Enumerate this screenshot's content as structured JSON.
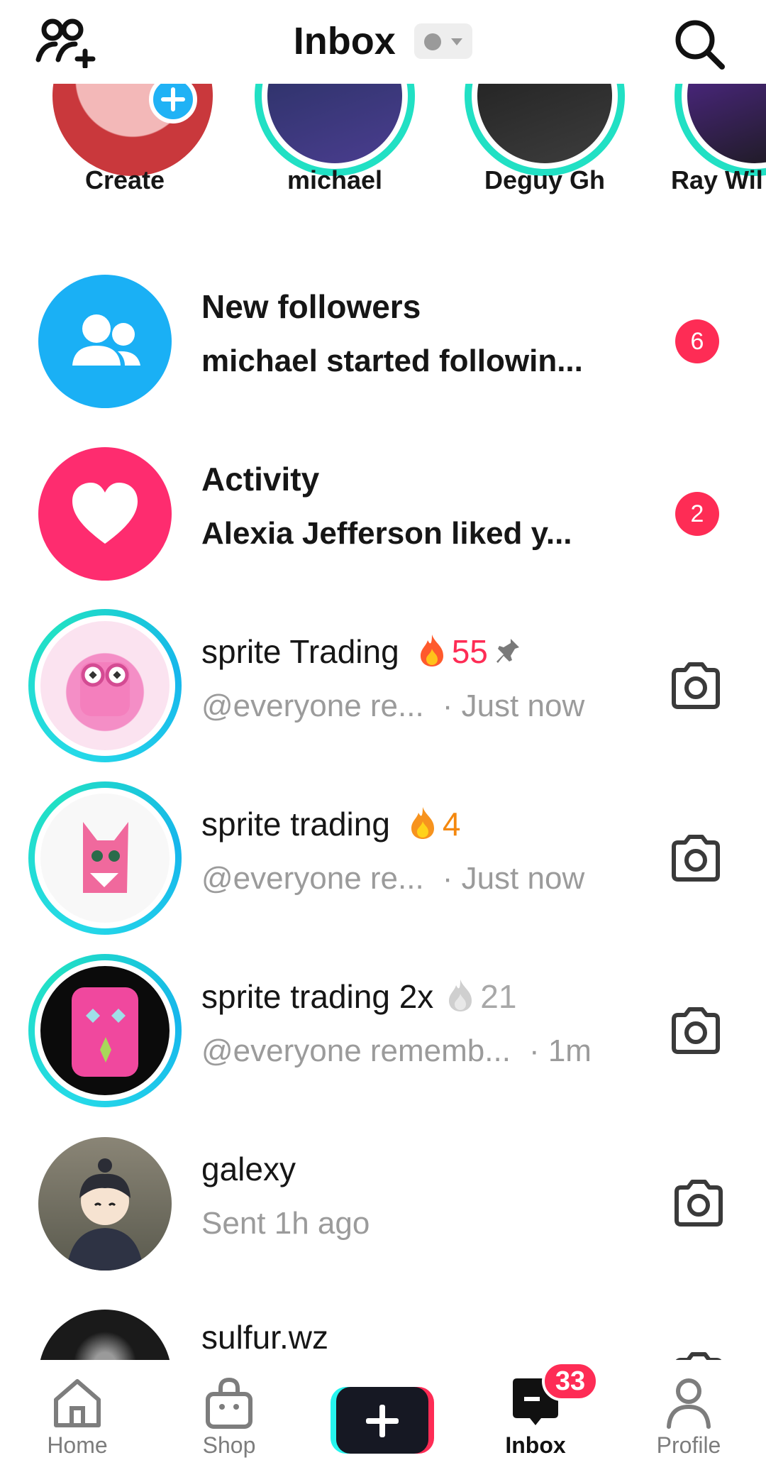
{
  "header": {
    "title": "Inbox",
    "left_icon": "add-friends-icon",
    "status_icon": "status-dropdown",
    "right_icon": "search-icon"
  },
  "stories": [
    {
      "label": "Create",
      "type": "create"
    },
    {
      "label": "michael",
      "type": "friend"
    },
    {
      "label": "Deguy Gh",
      "type": "friend"
    },
    {
      "label": "Ray Wil",
      "type": "friend"
    }
  ],
  "system_rows": [
    {
      "title": "New followers",
      "subtitle": "michael started followin...",
      "badge": "6",
      "icon": "followers-icon",
      "color": "#1ab0f5"
    },
    {
      "title": "Activity",
      "subtitle": "Alexia Jefferson liked y...",
      "badge": "2",
      "icon": "heart-icon",
      "color": "#fe2c6f"
    }
  ],
  "chats": [
    {
      "name": "sprite Trading",
      "streak": "55",
      "streak_state": "active",
      "pinned": true,
      "preview": "@everyone re...",
      "time": "· Just now"
    },
    {
      "name": "sprite trading",
      "streak": "4",
      "streak_state": "active",
      "pinned": false,
      "preview": "@everyone re...",
      "time": "· Just now"
    },
    {
      "name": "sprite trading 2x",
      "streak": "21",
      "streak_state": "expiring",
      "pinned": false,
      "preview": "@everyone rememb...",
      "time": "· 1m"
    },
    {
      "name": "galexy",
      "streak": "",
      "pinned": false,
      "preview": "Sent 1h ago",
      "time": ""
    },
    {
      "name": "sulfur.wz",
      "streak": "",
      "pinned": false,
      "preview": "",
      "time": ""
    }
  ],
  "bottom_nav": {
    "items": [
      {
        "label": "Home",
        "icon": "home-icon"
      },
      {
        "label": "Shop",
        "icon": "shop-bag-icon"
      },
      {
        "label": "",
        "icon": "create-plus-icon"
      },
      {
        "label": "Inbox",
        "icon": "inbox-icon",
        "badge": "33",
        "active": true
      },
      {
        "label": "Profile",
        "icon": "profile-icon"
      }
    ]
  },
  "colors": {
    "accent": "#fe2c55",
    "streak_orange": "#f4a30f",
    "streak_red": "#ff3b5c",
    "ring_teal": "#21e0c4",
    "muted_text": "#9b9b9b"
  }
}
